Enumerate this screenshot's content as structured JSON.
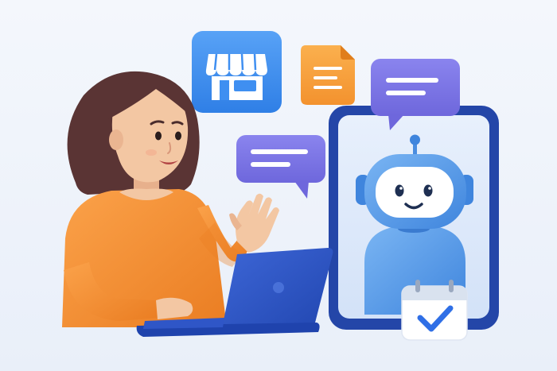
{
  "scene": {
    "background": "#eef3fb",
    "elements": [
      {
        "name": "woman",
        "shirt_color": "#f7953a",
        "hair_color": "#5a3434",
        "skin_color": "#f3c7a3"
      },
      {
        "name": "laptop",
        "color": "#2f56c7"
      },
      {
        "name": "phone",
        "frame_color": "#2446a8",
        "screen_color": "#dbe8fb"
      },
      {
        "name": "robot-assistant",
        "color": "#5fa0ea"
      },
      {
        "name": "store-icon",
        "tile_color": "#3f8ff1"
      },
      {
        "name": "document-icon",
        "tile_color": "#f7a03b"
      },
      {
        "name": "chat-bubble-icon",
        "count": 2,
        "color": "#7b74e6"
      },
      {
        "name": "calendar-check-icon",
        "check_color": "#2f6fe6"
      }
    ]
  }
}
